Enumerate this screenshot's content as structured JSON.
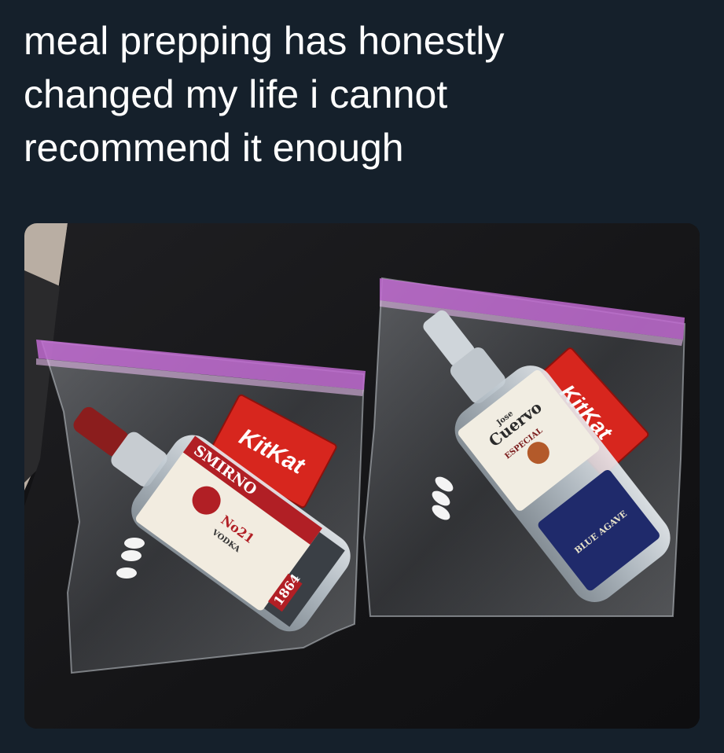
{
  "tweet": {
    "lines": [
      "meal prepping has honestly",
      "changed my life i cannot",
      "recommend it enough"
    ]
  },
  "photo": {
    "bag_left": {
      "bottle_brand": "SMIRNO",
      "bottle_number": "No21",
      "bottle_type": "VODKA",
      "bottle_year": "1864",
      "candy": "KitKat"
    },
    "bag_right": {
      "bottle_brand_small": "Jose",
      "bottle_brand": "Cuervo",
      "bottle_sub": "ESPECIAL",
      "bottle_neck": "BLUE AGAVE",
      "candy": "KitKat"
    }
  },
  "colors": {
    "background": "#15202b",
    "text": "#ffffff",
    "table": "#121214",
    "zipper": "#c06ad0",
    "kitkat": "#d7261e"
  }
}
